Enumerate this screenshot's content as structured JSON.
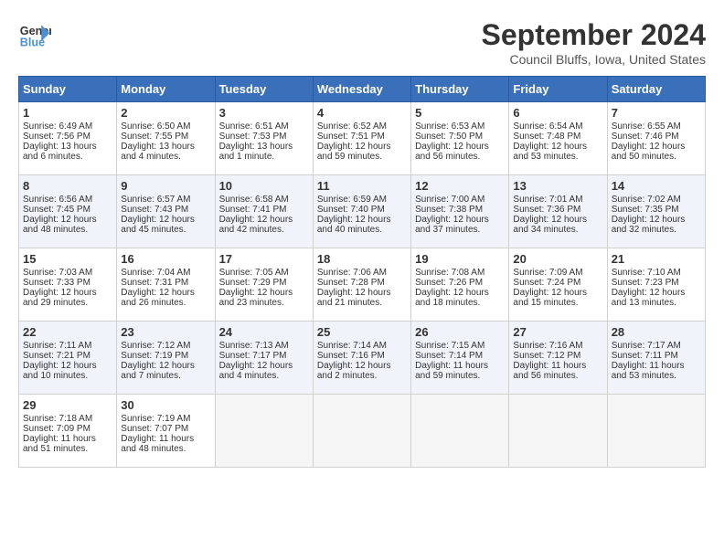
{
  "header": {
    "logo_line1": "General",
    "logo_line2": "Blue",
    "month": "September 2024",
    "location": "Council Bluffs, Iowa, United States"
  },
  "weekdays": [
    "Sunday",
    "Monday",
    "Tuesday",
    "Wednesday",
    "Thursday",
    "Friday",
    "Saturday"
  ],
  "weeks": [
    [
      {
        "day": 1,
        "lines": [
          "Sunrise: 6:49 AM",
          "Sunset: 7:56 PM",
          "Daylight: 13 hours",
          "and 6 minutes."
        ]
      },
      {
        "day": 2,
        "lines": [
          "Sunrise: 6:50 AM",
          "Sunset: 7:55 PM",
          "Daylight: 13 hours",
          "and 4 minutes."
        ]
      },
      {
        "day": 3,
        "lines": [
          "Sunrise: 6:51 AM",
          "Sunset: 7:53 PM",
          "Daylight: 13 hours",
          "and 1 minute."
        ]
      },
      {
        "day": 4,
        "lines": [
          "Sunrise: 6:52 AM",
          "Sunset: 7:51 PM",
          "Daylight: 12 hours",
          "and 59 minutes."
        ]
      },
      {
        "day": 5,
        "lines": [
          "Sunrise: 6:53 AM",
          "Sunset: 7:50 PM",
          "Daylight: 12 hours",
          "and 56 minutes."
        ]
      },
      {
        "day": 6,
        "lines": [
          "Sunrise: 6:54 AM",
          "Sunset: 7:48 PM",
          "Daylight: 12 hours",
          "and 53 minutes."
        ]
      },
      {
        "day": 7,
        "lines": [
          "Sunrise: 6:55 AM",
          "Sunset: 7:46 PM",
          "Daylight: 12 hours",
          "and 50 minutes."
        ]
      }
    ],
    [
      {
        "day": 8,
        "lines": [
          "Sunrise: 6:56 AM",
          "Sunset: 7:45 PM",
          "Daylight: 12 hours",
          "and 48 minutes."
        ]
      },
      {
        "day": 9,
        "lines": [
          "Sunrise: 6:57 AM",
          "Sunset: 7:43 PM",
          "Daylight: 12 hours",
          "and 45 minutes."
        ]
      },
      {
        "day": 10,
        "lines": [
          "Sunrise: 6:58 AM",
          "Sunset: 7:41 PM",
          "Daylight: 12 hours",
          "and 42 minutes."
        ]
      },
      {
        "day": 11,
        "lines": [
          "Sunrise: 6:59 AM",
          "Sunset: 7:40 PM",
          "Daylight: 12 hours",
          "and 40 minutes."
        ]
      },
      {
        "day": 12,
        "lines": [
          "Sunrise: 7:00 AM",
          "Sunset: 7:38 PM",
          "Daylight: 12 hours",
          "and 37 minutes."
        ]
      },
      {
        "day": 13,
        "lines": [
          "Sunrise: 7:01 AM",
          "Sunset: 7:36 PM",
          "Daylight: 12 hours",
          "and 34 minutes."
        ]
      },
      {
        "day": 14,
        "lines": [
          "Sunrise: 7:02 AM",
          "Sunset: 7:35 PM",
          "Daylight: 12 hours",
          "and 32 minutes."
        ]
      }
    ],
    [
      {
        "day": 15,
        "lines": [
          "Sunrise: 7:03 AM",
          "Sunset: 7:33 PM",
          "Daylight: 12 hours",
          "and 29 minutes."
        ]
      },
      {
        "day": 16,
        "lines": [
          "Sunrise: 7:04 AM",
          "Sunset: 7:31 PM",
          "Daylight: 12 hours",
          "and 26 minutes."
        ]
      },
      {
        "day": 17,
        "lines": [
          "Sunrise: 7:05 AM",
          "Sunset: 7:29 PM",
          "Daylight: 12 hours",
          "and 23 minutes."
        ]
      },
      {
        "day": 18,
        "lines": [
          "Sunrise: 7:06 AM",
          "Sunset: 7:28 PM",
          "Daylight: 12 hours",
          "and 21 minutes."
        ]
      },
      {
        "day": 19,
        "lines": [
          "Sunrise: 7:08 AM",
          "Sunset: 7:26 PM",
          "Daylight: 12 hours",
          "and 18 minutes."
        ]
      },
      {
        "day": 20,
        "lines": [
          "Sunrise: 7:09 AM",
          "Sunset: 7:24 PM",
          "Daylight: 12 hours",
          "and 15 minutes."
        ]
      },
      {
        "day": 21,
        "lines": [
          "Sunrise: 7:10 AM",
          "Sunset: 7:23 PM",
          "Daylight: 12 hours",
          "and 13 minutes."
        ]
      }
    ],
    [
      {
        "day": 22,
        "lines": [
          "Sunrise: 7:11 AM",
          "Sunset: 7:21 PM",
          "Daylight: 12 hours",
          "and 10 minutes."
        ]
      },
      {
        "day": 23,
        "lines": [
          "Sunrise: 7:12 AM",
          "Sunset: 7:19 PM",
          "Daylight: 12 hours",
          "and 7 minutes."
        ]
      },
      {
        "day": 24,
        "lines": [
          "Sunrise: 7:13 AM",
          "Sunset: 7:17 PM",
          "Daylight: 12 hours",
          "and 4 minutes."
        ]
      },
      {
        "day": 25,
        "lines": [
          "Sunrise: 7:14 AM",
          "Sunset: 7:16 PM",
          "Daylight: 12 hours",
          "and 2 minutes."
        ]
      },
      {
        "day": 26,
        "lines": [
          "Sunrise: 7:15 AM",
          "Sunset: 7:14 PM",
          "Daylight: 11 hours",
          "and 59 minutes."
        ]
      },
      {
        "day": 27,
        "lines": [
          "Sunrise: 7:16 AM",
          "Sunset: 7:12 PM",
          "Daylight: 11 hours",
          "and 56 minutes."
        ]
      },
      {
        "day": 28,
        "lines": [
          "Sunrise: 7:17 AM",
          "Sunset: 7:11 PM",
          "Daylight: 11 hours",
          "and 53 minutes."
        ]
      }
    ],
    [
      {
        "day": 29,
        "lines": [
          "Sunrise: 7:18 AM",
          "Sunset: 7:09 PM",
          "Daylight: 11 hours",
          "and 51 minutes."
        ]
      },
      {
        "day": 30,
        "lines": [
          "Sunrise: 7:19 AM",
          "Sunset: 7:07 PM",
          "Daylight: 11 hours",
          "and 48 minutes."
        ]
      },
      null,
      null,
      null,
      null,
      null
    ]
  ]
}
